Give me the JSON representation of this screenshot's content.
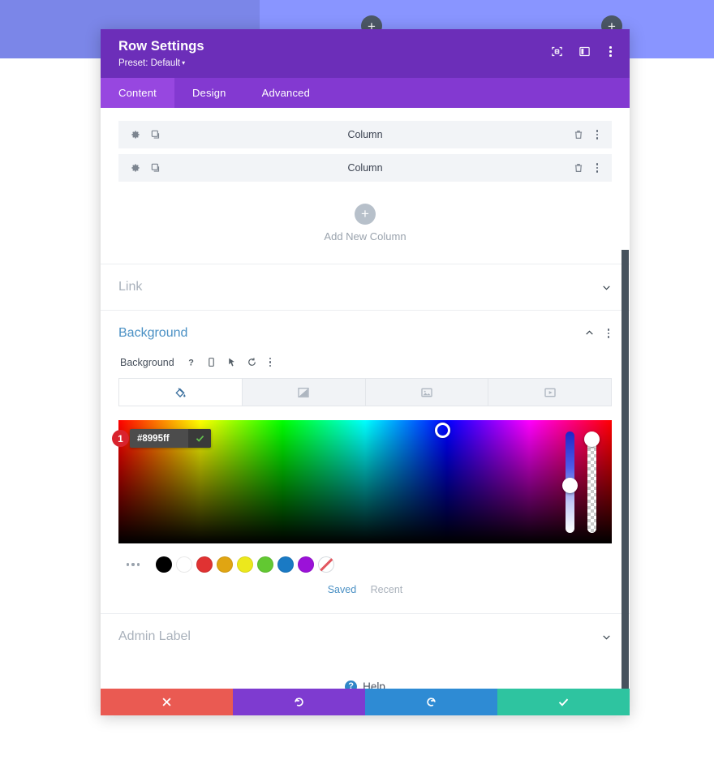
{
  "banner": {
    "plus_label": "+",
    "left_color": "#7b86e8",
    "right_color": "#8995ff"
  },
  "modal": {
    "title": "Row Settings",
    "preset_label": "Preset: Default",
    "preset_caret": "▾",
    "header_icons": [
      "focus-target-icon",
      "split-panel-icon",
      "more-vertical-icon"
    ],
    "tabs": [
      {
        "label": "Content",
        "active": true
      },
      {
        "label": "Design",
        "active": false
      },
      {
        "label": "Advanced",
        "active": false
      }
    ]
  },
  "columns": {
    "rows": [
      {
        "name": "Column"
      },
      {
        "name": "Column"
      }
    ],
    "add_new_label": "Add New Column",
    "add_new_plus": "+"
  },
  "sections": {
    "link": {
      "title": "Link",
      "open": false
    },
    "background": {
      "title": "Background",
      "open": true
    },
    "admin_label": {
      "title": "Admin Label",
      "open": false
    }
  },
  "background": {
    "field_label": "Background",
    "field_icons": [
      "help-icon",
      "responsive-device-icon",
      "hover-cursor-icon",
      "reset-icon",
      "more-vertical-icon"
    ],
    "type_tabs": [
      {
        "name": "color-tab",
        "active": true
      },
      {
        "name": "gradient-tab",
        "active": false
      },
      {
        "name": "image-tab",
        "active": false
      },
      {
        "name": "video-tab",
        "active": false
      }
    ],
    "hex_value": "#8995ff",
    "hex_placeholder": "#ffffff",
    "annotation_badge": "1",
    "swatches": [
      {
        "name": "black",
        "color": "#000000"
      },
      {
        "name": "white",
        "color": "#ffffff"
      },
      {
        "name": "red",
        "color": "#e03232"
      },
      {
        "name": "orange",
        "color": "#e0a512"
      },
      {
        "name": "yellow",
        "color": "#ece81c"
      },
      {
        "name": "green",
        "color": "#62c832"
      },
      {
        "name": "blue",
        "color": "#1a7ac4"
      },
      {
        "name": "purple",
        "color": "#9b12d8"
      },
      {
        "name": "none",
        "color": "transparent"
      }
    ],
    "palette_tabs": [
      {
        "label": "Saved",
        "active": true
      },
      {
        "label": "Recent",
        "active": false
      }
    ]
  },
  "help": {
    "label": "Help",
    "icon_char": "?"
  },
  "footer": {
    "buttons": [
      {
        "name": "cancel-button",
        "color": "#ea5a52"
      },
      {
        "name": "undo-button",
        "color": "#7e3bd0"
      },
      {
        "name": "redo-button",
        "color": "#2e8bd4"
      },
      {
        "name": "save-button",
        "color": "#2ec4a0"
      }
    ]
  }
}
